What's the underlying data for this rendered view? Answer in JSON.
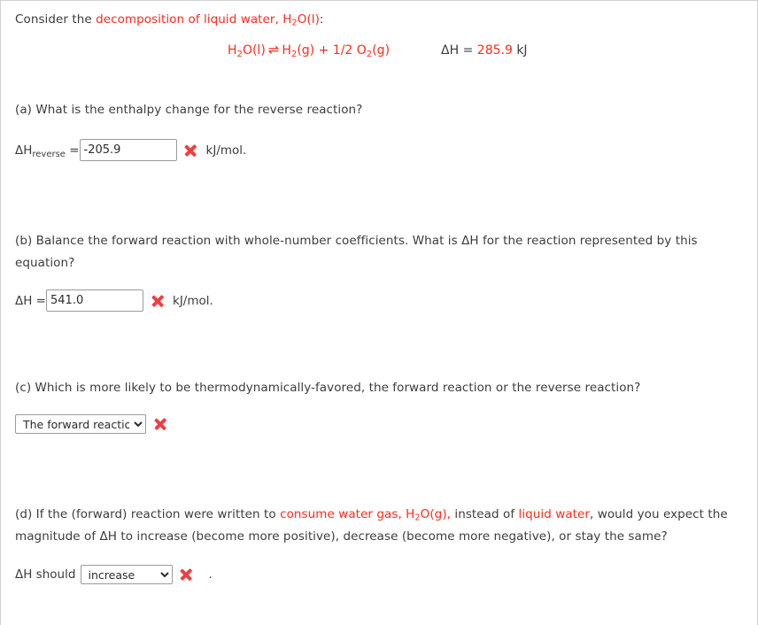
{
  "prompt": {
    "lead_plain_1": "Consider the ",
    "lead_highlight": "decomposition of liquid water, H",
    "lead_highlight_sub": "2",
    "lead_highlight_tail": "O(l)",
    "lead_plain_2": ":",
    "equation": {
      "reactant": "H",
      "reactant_sub": "2",
      "reactant_tail": "O(l)",
      "arrow": "⇌",
      "product1": "H",
      "product1_sub": "2",
      "product1_tail": "(g)",
      "plus": "+",
      "coefficient": "1/2",
      "product2": "O",
      "product2_sub": "2",
      "product2_tail": "(g)",
      "dh_label": "ΔH = ",
      "dh_value": "285.9",
      "dh_unit": " kJ"
    }
  },
  "part_a": {
    "question": "(a) What is the enthalpy change for the reverse reaction?",
    "label_prefix": "ΔH",
    "label_sub": "reverse",
    "label_equals": " = ",
    "input_value": "-205.9",
    "input_placeholder": "",
    "feedback_icon": "incorrect-x-icon",
    "unit": "kJ/mol."
  },
  "part_b": {
    "question": "(b) Balance the forward reaction with whole-number coefficients. What is ΔH for the reaction represented by this equation?",
    "label": "ΔH = ",
    "input_value": "541.0",
    "input_placeholder": "",
    "feedback_icon": "incorrect-x-icon",
    "unit": "kJ/mol."
  },
  "part_c": {
    "question": "(c) Which is more likely to be thermodynamically-favored, the forward reaction or the reverse reaction?",
    "selected": "The forward reaction.",
    "options": [
      "The forward reaction."
    ],
    "feedback_icon": "incorrect-x-icon"
  },
  "part_d": {
    "question_line1_a": "(d) If the (forward) reaction were written to ",
    "question_line1_red1": "consume water gas, H",
    "question_line1_red1_sub": "2",
    "question_line1_red1_tail": "O(g),",
    "question_line1_b": " instead of ",
    "question_line1_red2": "liquid water",
    "question_line1_c": ", would you expect the",
    "question_line2": "magnitude of ΔH to increase (become more positive), decrease (become more negative), or stay the same?",
    "label": "ΔH should",
    "selected": "increase",
    "options": [
      "increase"
    ],
    "feedback_icon": "incorrect-x-icon",
    "trailing_period": "."
  },
  "colors": {
    "highlight_red": "#fb2b1e",
    "feedback_red": "#ef3e42",
    "body_text": "#3c3c3c",
    "border_gray": "#d2d2d2"
  }
}
